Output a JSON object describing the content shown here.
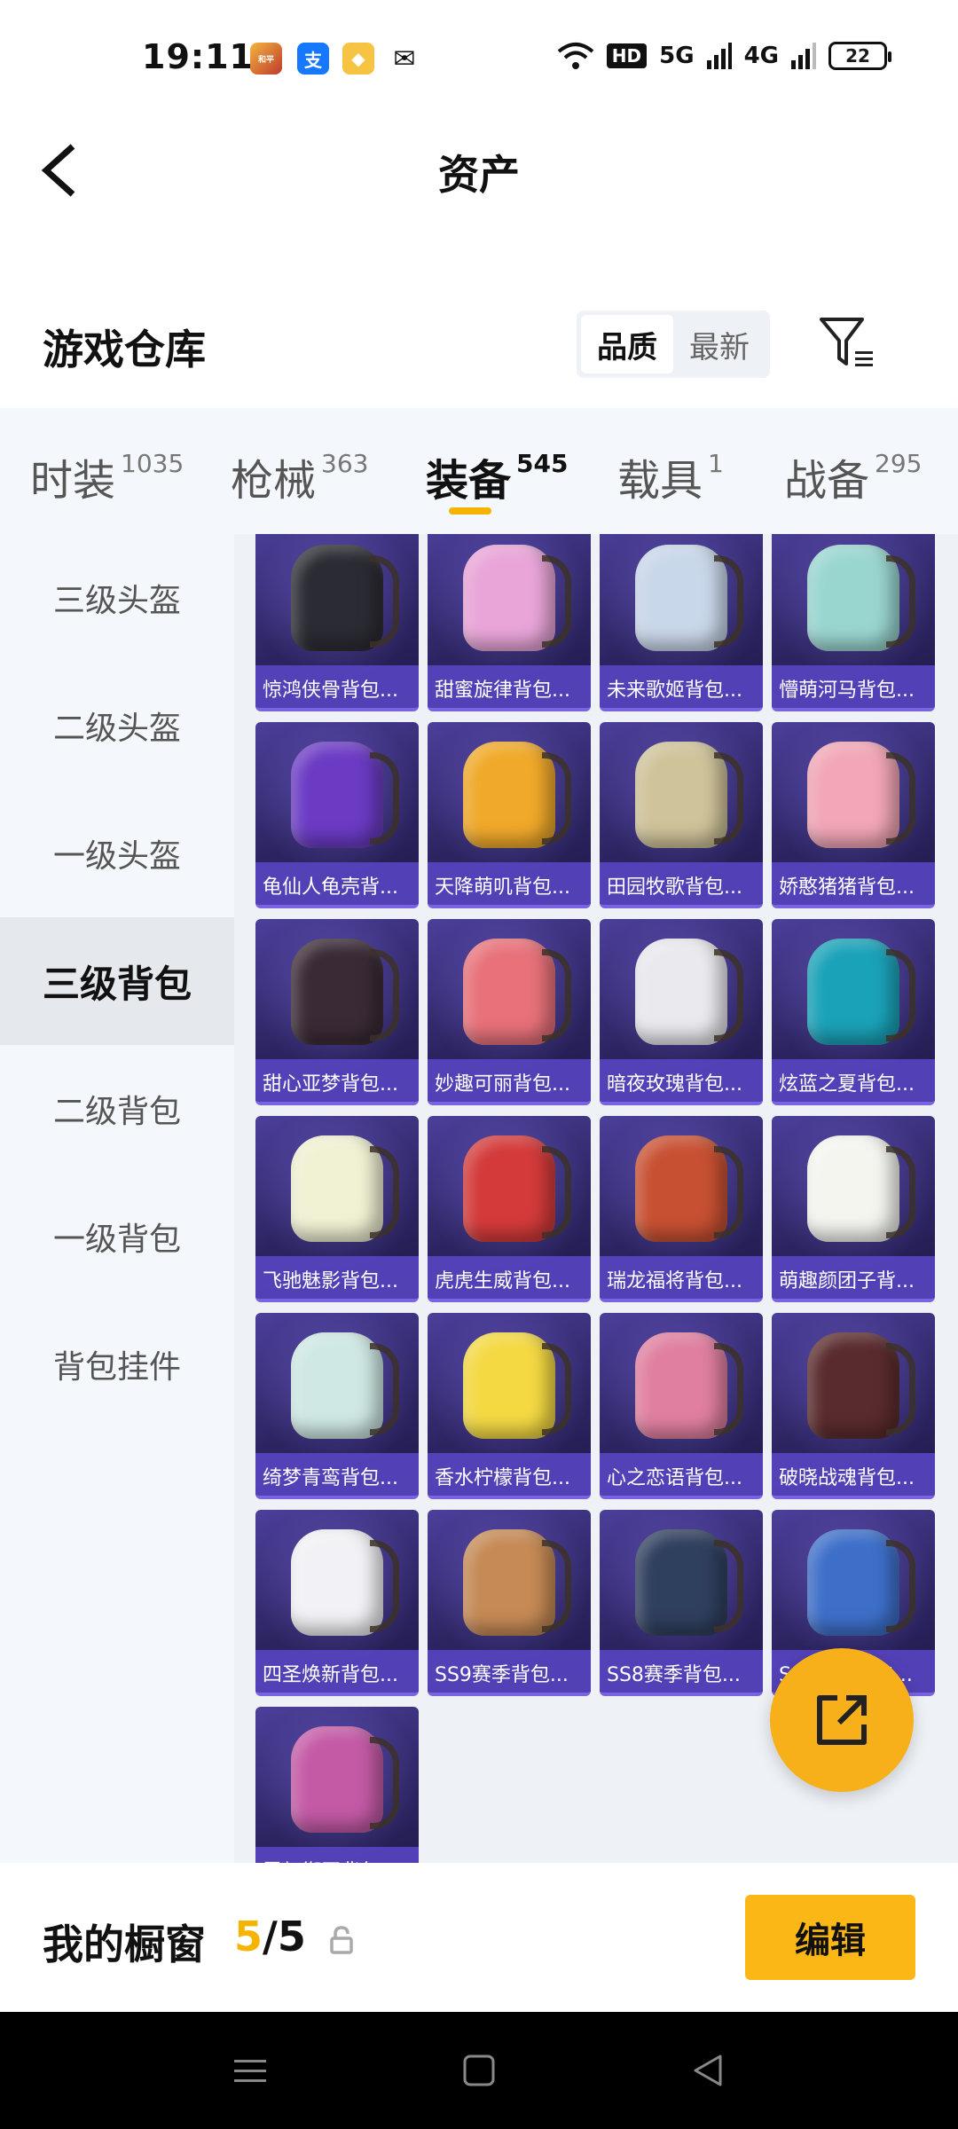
{
  "status_bar": {
    "time": "19:11",
    "hd_badge": "HD",
    "net1": "5G",
    "net2": "4G",
    "battery": "22"
  },
  "header": {
    "title": "资产"
  },
  "warehouse": {
    "title": "游戏仓库",
    "sort_options": [
      "品质",
      "最新"
    ],
    "active_sort": "品质"
  },
  "tabs": [
    {
      "label": "时装",
      "count": "1035"
    },
    {
      "label": "枪械",
      "count": "363"
    },
    {
      "label": "装备",
      "count": "545"
    },
    {
      "label": "载具",
      "count": "1"
    },
    {
      "label": "战备",
      "count": "295"
    }
  ],
  "sidebar": {
    "items": [
      "三级头盔",
      "二级头盔",
      "一级头盔",
      "三级背包",
      "二级背包",
      "一级背包",
      "背包挂件"
    ],
    "active": "三级背包"
  },
  "items": [
    {
      "name": "惊鸿侠骨背包...",
      "color": "#2b2b33"
    },
    {
      "name": "甜蜜旋律背包...",
      "color": "#e9a5d8"
    },
    {
      "name": "未来歌姬背包...",
      "color": "#c9d7ea"
    },
    {
      "name": "懵萌河马背包...",
      "color": "#9ad6d0"
    },
    {
      "name": "龟仙人龟壳背...",
      "color": "#6b3bc4"
    },
    {
      "name": "天降萌叽背包...",
      "color": "#f0a92a"
    },
    {
      "name": "田园牧歌背包...",
      "color": "#cfc39a"
    },
    {
      "name": "娇憨猪猪背包...",
      "color": "#f2a6b6"
    },
    {
      "name": "甜心亚梦背包...",
      "color": "#3a2a35"
    },
    {
      "name": "妙趣可丽背包...",
      "color": "#e8717a"
    },
    {
      "name": "暗夜玫瑰背包...",
      "color": "#e9e9ee"
    },
    {
      "name": "炫蓝之夏背包...",
      "color": "#1aa2b8"
    },
    {
      "name": "飞驰魅影背包...",
      "color": "#f1f1d4"
    },
    {
      "name": "虎虎生威背包...",
      "color": "#d43a3a"
    },
    {
      "name": "瑞龙福将背包...",
      "color": "#c85032"
    },
    {
      "name": "萌趣颜团子背...",
      "color": "#f5f5f0"
    },
    {
      "name": "绮梦青鸾背包...",
      "color": "#cfe8e4"
    },
    {
      "name": "香水柠檬背包...",
      "color": "#f4d943"
    },
    {
      "name": "心之恋语背包...",
      "color": "#e07fa0"
    },
    {
      "name": "破晓战魂背包...",
      "color": "#5a2b2e"
    },
    {
      "name": "四圣焕新背包...",
      "color": "#f2f2f6"
    },
    {
      "name": "SS9赛季背包...",
      "color": "#c58a55"
    },
    {
      "name": "SS8赛季背包...",
      "color": "#2f3f5e"
    },
    {
      "name": "SS7赛季背包...",
      "color": "#3d6fc9"
    },
    {
      "name": "霓虹街区背包...",
      "color": "#c45aa6"
    }
  ],
  "showcase": {
    "title": "我的橱窗",
    "current": "5",
    "total": "/5",
    "edit_label": "编辑"
  },
  "colors": {
    "accent": "#f5b400",
    "card_bg": "#2d2563"
  }
}
